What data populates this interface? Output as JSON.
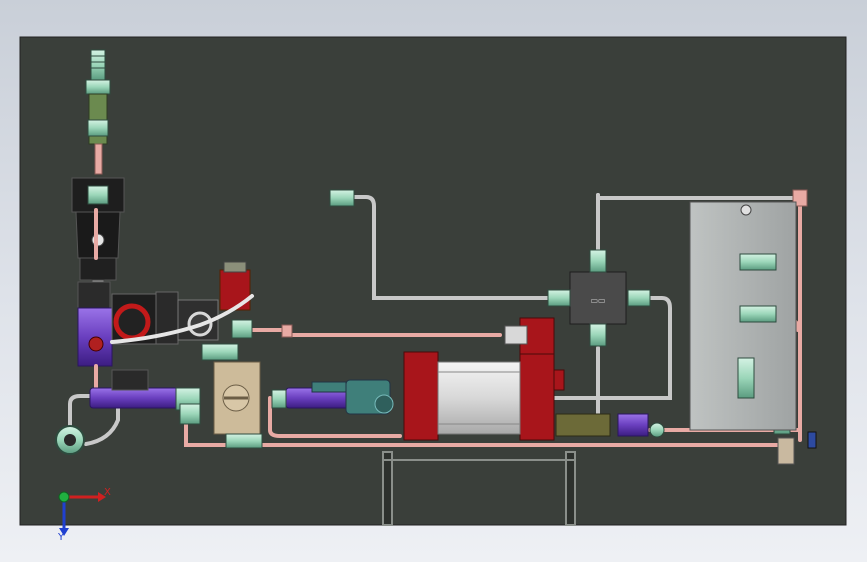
{
  "axis_triad": {
    "x_label": "X",
    "y_label": "Y"
  },
  "colors": {
    "background_top": "#c9cfd8",
    "background_bottom": "#eef0f4",
    "panel": "#3a3f3a",
    "copper_tube": "#e8aaa4",
    "steel_tube": "#c8c8c8",
    "pump_frame": "#a8151b",
    "purple_fitting": "#6a3fbf",
    "brass_block": "#cdbb9a",
    "green_fitting": "#9bd6b9"
  }
}
